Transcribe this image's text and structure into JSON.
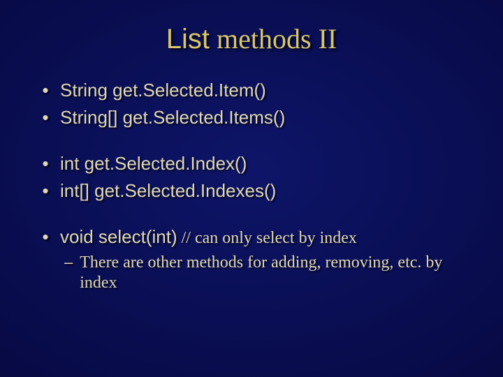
{
  "title": {
    "word1": "List",
    "rest": " methods II"
  },
  "groups": [
    {
      "bullets": [
        {
          "text": "String get.Selected.Item()"
        },
        {
          "text": "String[] get.Selected.Items()"
        }
      ]
    },
    {
      "bullets": [
        {
          "text": "int get.Selected.Index()"
        },
        {
          "text": "int[] get.Selected.Indexes()"
        }
      ]
    },
    {
      "bullets": [
        {
          "text": "void select(int)",
          "comment": "  // can only select by index",
          "sub": "There are other methods for adding, removing, etc. by index"
        }
      ]
    }
  ]
}
